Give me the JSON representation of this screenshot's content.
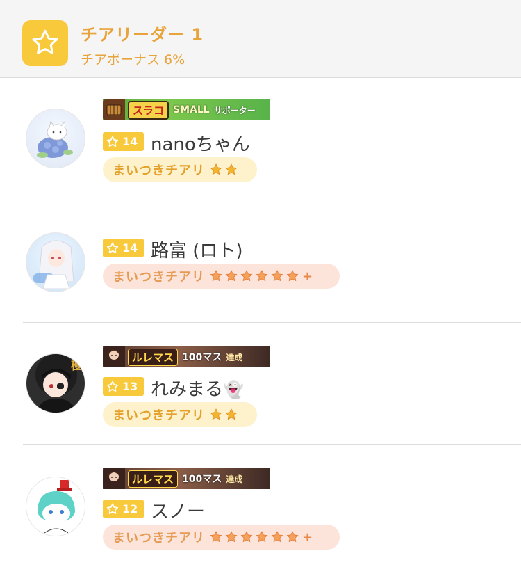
{
  "header": {
    "title": "チアリーダー 1",
    "subtitle": "チアボーナス 6%",
    "icon": "star-icon",
    "accent": "#f8c93a",
    "text_color": "#e8a43a"
  },
  "members": [
    {
      "banner": {
        "style": "green",
        "text1": "スラコ",
        "text2": "SMALL",
        "text3": "サポーター"
      },
      "level": "14",
      "name": "nanoちゃん",
      "badge": {
        "label": "まいつきチアリ",
        "style": "yellow",
        "stars": 2,
        "plus": false
      }
    },
    {
      "banner": null,
      "level": "14",
      "name": "路富 (ロト)",
      "badge": {
        "label": "まいつきチアリ",
        "style": "pink",
        "stars": 6,
        "plus": true,
        "plus_text": "+"
      }
    },
    {
      "banner": {
        "style": "brown",
        "text1": "ルレマス",
        "text2": "100マス",
        "text3": "達成"
      },
      "level": "13",
      "name": "れみまる",
      "name_emoji": "👻",
      "badge": {
        "label": "まいつきチアリ",
        "style": "yellow",
        "stars": 2,
        "plus": false
      }
    },
    {
      "banner": {
        "style": "brown",
        "text1": "ルレマス",
        "text2": "100マス",
        "text3": "達成"
      },
      "level": "12",
      "name": "スノー",
      "badge": {
        "label": "まいつきチアリ",
        "style": "pink",
        "stars": 6,
        "plus": true,
        "plus_text": "+"
      }
    }
  ]
}
